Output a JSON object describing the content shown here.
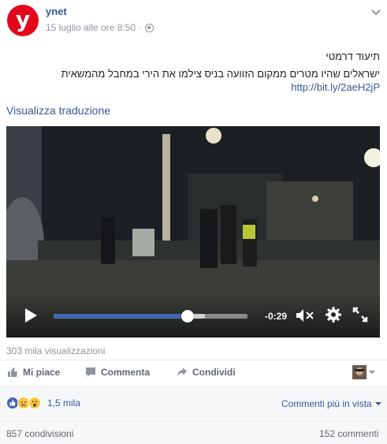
{
  "post": {
    "page_name": "ynet",
    "logo_letter": "y",
    "timestamp": "15 luglio alle ore 8:50",
    "separator": "·",
    "text_line1": "תיעוד דרמטי",
    "text_line2": "ישראלים שהיו מטרים ממקום הזוועה בניס צילמו את הירי במחבל מהמשאית",
    "link": "http://bit.ly/2aeH2jP",
    "translate_label": "Visualizza traduzione"
  },
  "video": {
    "time_remaining": "-0:29",
    "progress": 0.69,
    "buffered": 0.78,
    "accent_color": "#4267b2"
  },
  "views": "303 mila visualizzazioni",
  "actions": {
    "like": "Mi piace",
    "comment": "Commenta",
    "share": "Condividi"
  },
  "reactions": {
    "count": "1,5 mila",
    "types": [
      "like-icon",
      "sad-icon",
      "wow-icon"
    ],
    "sort_label": "Commenti più in vista"
  },
  "footer": {
    "shares": "857 condivisioni",
    "comments": "152 commenti"
  }
}
